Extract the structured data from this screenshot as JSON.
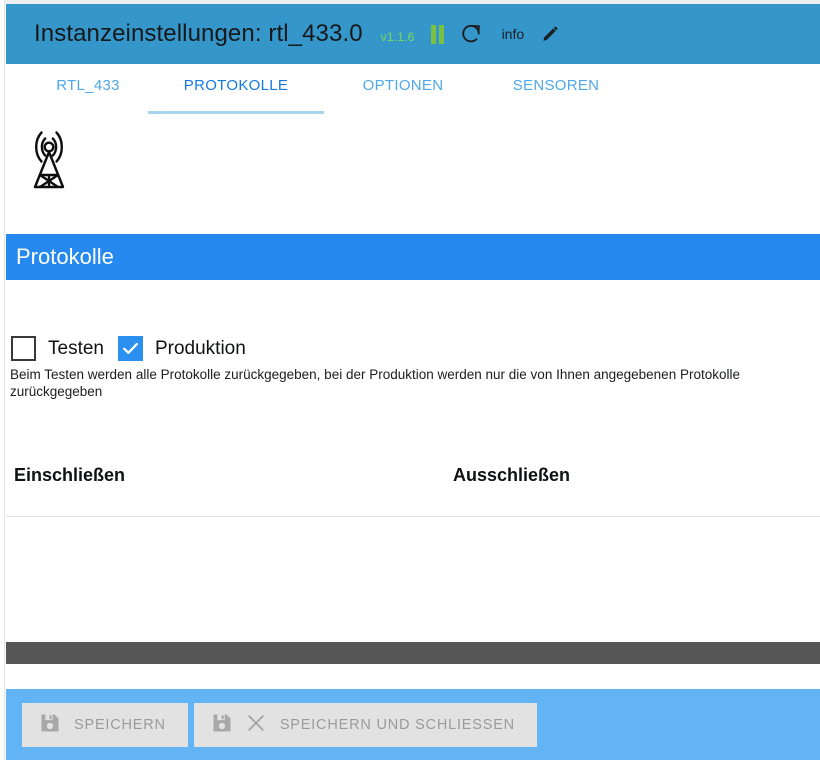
{
  "header": {
    "title": "Instanzeinstellungen: rtl_433.0",
    "version": "v1.1.6",
    "pause_icon": "pause-icon",
    "refresh_icon": "refresh-icon",
    "info_label": "info",
    "edit_icon": "pencil-icon",
    "accent_color": "#3496c9",
    "version_color": "#7ed957"
  },
  "tabs": [
    {
      "label": "RTL_433",
      "active": false
    },
    {
      "label": "PROTOKOLLE",
      "active": true
    },
    {
      "label": "OPTIONEN",
      "active": false
    },
    {
      "label": "SENSOREN",
      "active": false
    }
  ],
  "logo": {
    "icon": "antenna-tower-icon"
  },
  "section": {
    "title": "Protokolle",
    "bar_color": "#2589ef"
  },
  "options": {
    "testen": {
      "label": "Testen",
      "checked": false
    },
    "produktion": {
      "label": "Produktion",
      "checked": true
    },
    "hint": "Beim Testen werden alle Protokolle zurückgegeben, bei der Produktion werden nur die von Ihnen angegebenen Protokolle zurückgegeben"
  },
  "columns": {
    "include_title": "Einschließen",
    "exclude_title": "Ausschließen"
  },
  "footer": {
    "bar_color": "#62b4f5",
    "buttons": [
      {
        "label": "SPEICHERN",
        "icons": [
          "save-icon"
        ]
      },
      {
        "label": "SPEICHERN UND SCHLIESSEN",
        "icons": [
          "save-icon",
          "close-icon"
        ]
      }
    ]
  }
}
